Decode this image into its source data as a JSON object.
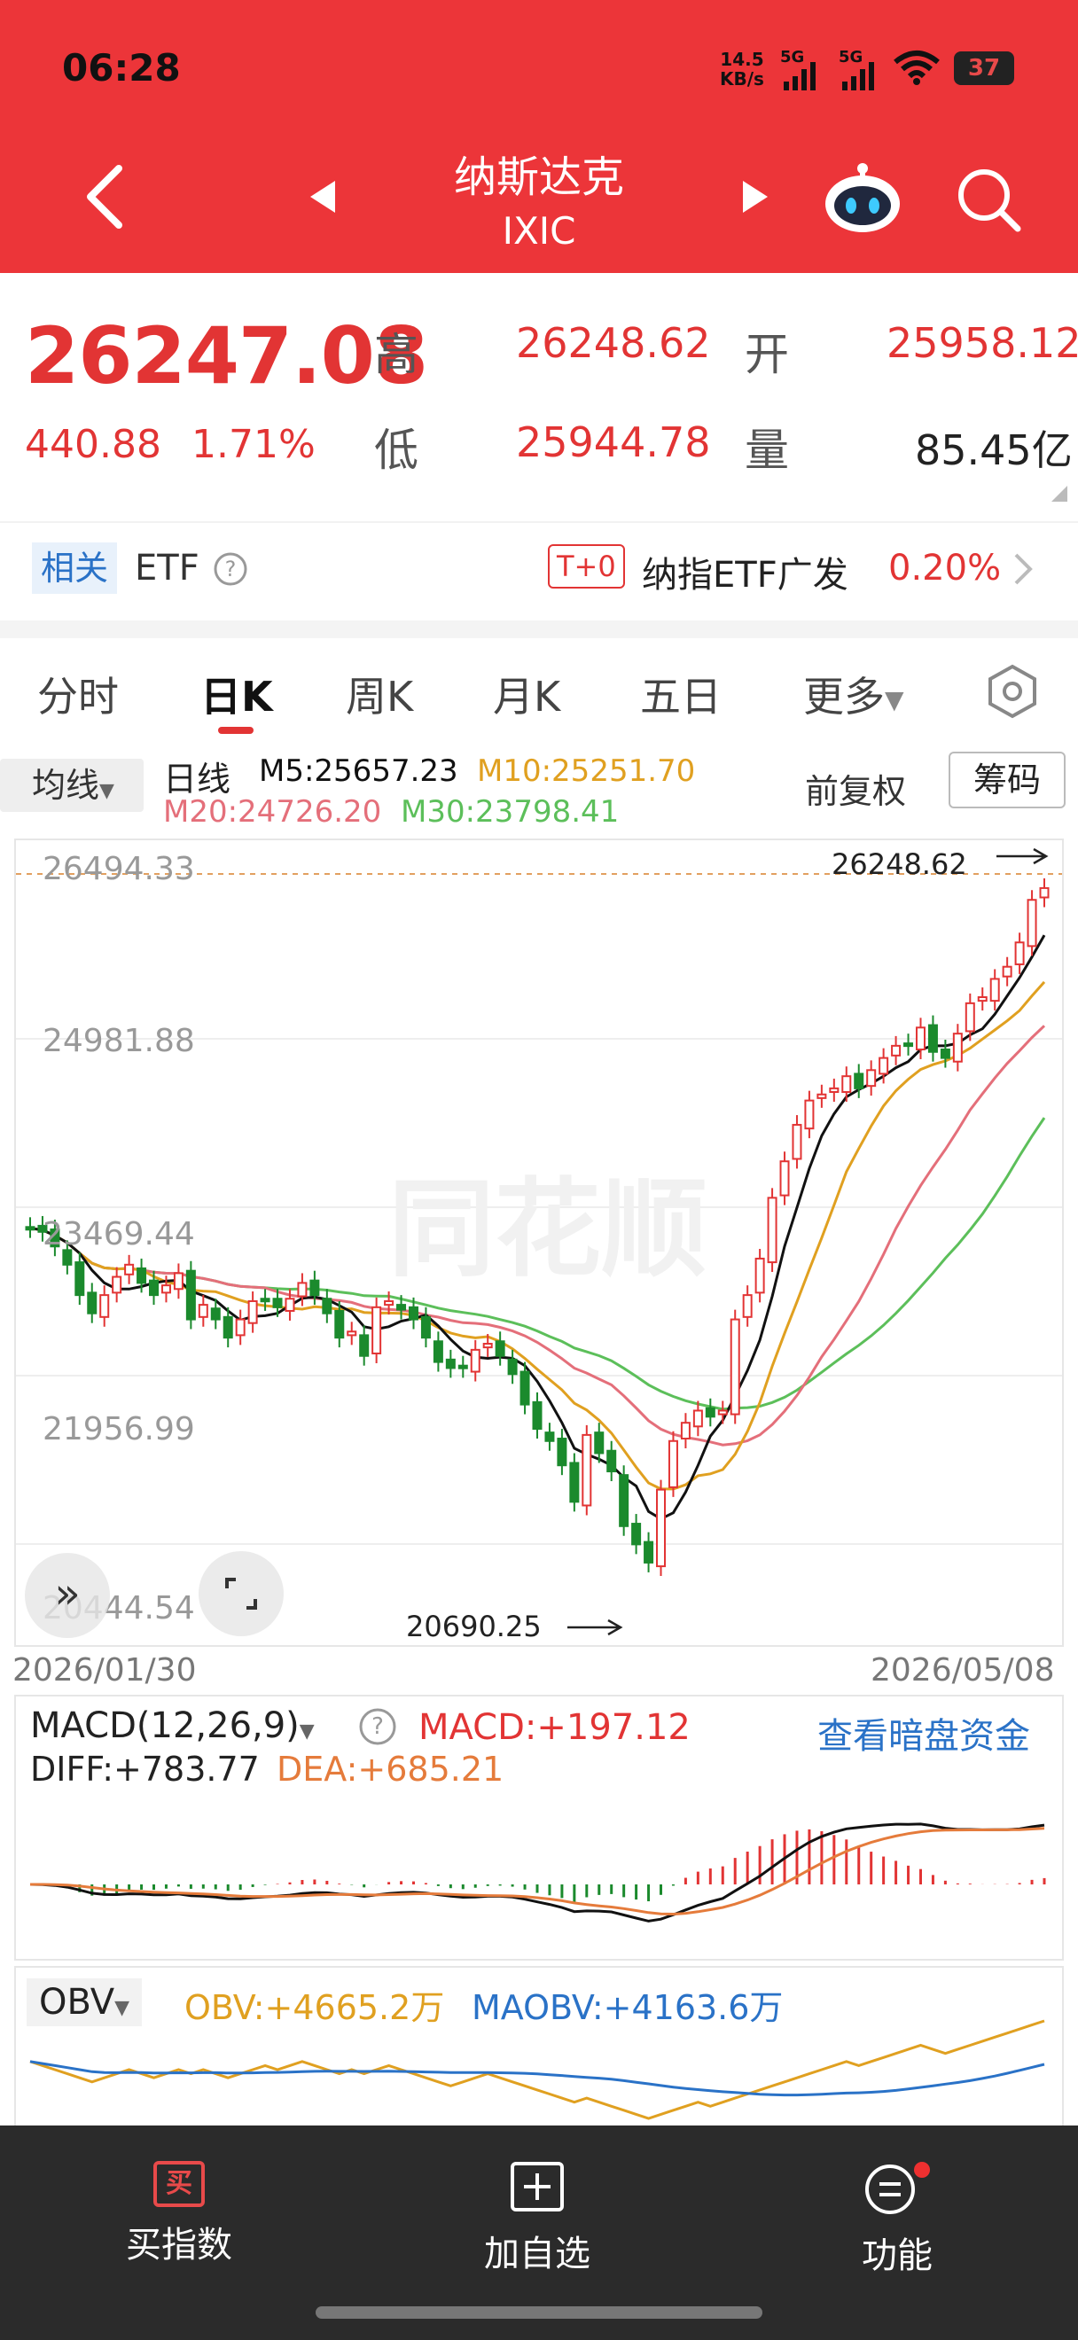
{
  "status": {
    "time": "06:28",
    "net_speed": "14.5",
    "net_unit": "KB/s",
    "sig1": "5G",
    "sig2": "5G",
    "battery": "37"
  },
  "header": {
    "title": "纳斯达克",
    "code": "IXIC"
  },
  "quote": {
    "price": "26247.08",
    "change": "440.88",
    "change_pct": "1.71%",
    "high_label": "高",
    "high": "26248.62",
    "open_label": "开",
    "open": "25958.12",
    "low_label": "低",
    "low": "25944.78",
    "vol_label": "量",
    "vol": "85.45亿"
  },
  "etf": {
    "tag": "相关",
    "label": "ETF",
    "t0": "T+0",
    "name": "纳指ETF广发",
    "pct": "0.20%"
  },
  "tabs": [
    "分时",
    "日K",
    "周K",
    "月K",
    "五日",
    "更多"
  ],
  "legend": {
    "ma_button": "均线",
    "period": "日线",
    "m5": "M5:25657.23",
    "m10": "M10:25251.70",
    "m20": "M20:24726.20",
    "m30": "M30:23798.41",
    "adjust": "前复权",
    "chips": "筹码",
    "colors": {
      "m5": "#111111",
      "m10": "#e0a020",
      "m20": "#e46f7a",
      "m30": "#5cbf5a",
      "up": "#e23434",
      "down": "#1b8a2d"
    }
  },
  "chart_data": {
    "type": "candlestick",
    "y_ticks": [
      "26494.33",
      "24981.88",
      "23469.44",
      "21956.99",
      "20444.54"
    ],
    "ylim": [
      20444.54,
      26494.33
    ],
    "x_start": "2026/01/30",
    "x_end": "2026/05/08",
    "max_marker": "26248.62",
    "min_marker": "20690.25",
    "watermark": "同花顺",
    "close": [
      23450,
      23420,
      23300,
      23150,
      22900,
      22750,
      22900,
      23050,
      23150,
      23000,
      22900,
      22980,
      23080,
      22700,
      22820,
      22700,
      22550,
      22700,
      22850,
      22850,
      22800,
      22870,
      23000,
      22900,
      22750,
      22550,
      22600,
      22400,
      22800,
      22850,
      22780,
      22700,
      22550,
      22350,
      22300,
      22300,
      22450,
      22500,
      22400,
      22250,
      22000,
      21800,
      21700,
      21500,
      21200,
      21750,
      21600,
      21450,
      21000,
      20850,
      20700,
      21300,
      21700,
      21850,
      21950,
      21900,
      21950,
      22700,
      22900,
      23200,
      23700,
      24000,
      24300,
      24500,
      24550,
      24600,
      24700,
      24600,
      24750,
      24850,
      24950,
      24950,
      25100,
      24900,
      24850,
      25050,
      25300,
      25350,
      25500,
      25600,
      25800,
      26150,
      26247
    ]
  },
  "macd": {
    "name": "MACD(12,26,9)",
    "macd": "MACD:+197.12",
    "diff": "DIFF:+783.77",
    "dea": "DEA:+685.21",
    "link": "查看暗盘资金"
  },
  "obv": {
    "name": "OBV",
    "obv": "OBV:+4665.2万",
    "maobv": "MAOBV:+4163.6万"
  },
  "bottom": {
    "buy_icon": "买",
    "buy": "买指数",
    "add": "加自选",
    "func": "功能"
  }
}
